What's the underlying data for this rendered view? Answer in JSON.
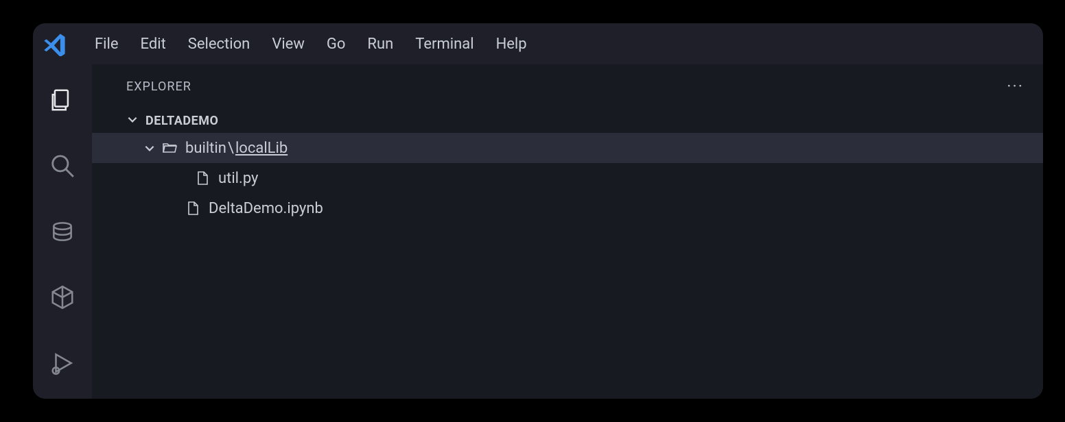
{
  "menubar": {
    "items": [
      "File",
      "Edit",
      "Selection",
      "View",
      "Go",
      "Run",
      "Terminal",
      "Help"
    ]
  },
  "sidebar": {
    "title": "EXPLORER",
    "section": "DELTADEMO",
    "folder": {
      "prefix": "builtin",
      "sep": "\\",
      "name": "localLib"
    },
    "files": {
      "util": "util.py",
      "notebook": "DeltaDemo.ipynb"
    }
  }
}
